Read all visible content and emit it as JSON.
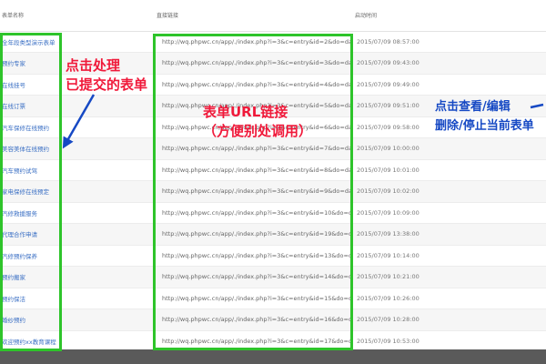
{
  "table": {
    "headers": {
      "name": "表单名称",
      "url": "直接链接",
      "time": "启动时间"
    },
    "rows": [
      {
        "name": "全年段类型演示表单",
        "url": "http://wq.phpwc.cn/app/./index.php?i=3&c=entry&id=2&do=dayu_form",
        "time": "2015/07/09 08:57:00"
      },
      {
        "name": "预约专家",
        "url": "http://wq.phpwc.cn/app/./index.php?i=3&c=entry&id=3&do=dayu_form",
        "time": "2015/07/09 09:43:00"
      },
      {
        "name": "在线挂号",
        "url": "http://wq.phpwc.cn/app/./index.php?i=3&c=entry&id=4&do=dayu_form",
        "time": "2015/07/09 09:49:00"
      },
      {
        "name": "在线订票",
        "url": "http://wq.phpwc.cn/app/./index.php?i=3&c=entry&id=5&do=dayu_form",
        "time": "2015/07/09 09:51:00"
      },
      {
        "name": "汽车保修在线预约",
        "url": "http://wq.phpwc.cn/app/./index.php?i=3&c=entry&id=6&do=dayu_form",
        "time": "2015/07/09 09:58:00"
      },
      {
        "name": "美容美体在线预约",
        "url": "http://wq.phpwc.cn/app/./index.php?i=3&c=entry&id=7&do=dayu_form",
        "time": "2015/07/09 10:00:00"
      },
      {
        "name": "汽车预约试驾",
        "url": "http://wq.phpwc.cn/app/./index.php?i=3&c=entry&id=8&do=dayu_form",
        "time": "2015/07/09 10:01:00"
      },
      {
        "name": "家电保修在线预定",
        "url": "http://wq.phpwc.cn/app/./index.php?i=3&c=entry&id=9&do=dayu_form",
        "time": "2015/07/09 10:02:00"
      },
      {
        "name": "汽修救援服务",
        "url": "http://wq.phpwc.cn/app/./index.php?i=3&c=entry&id=10&do=dayu_form",
        "time": "2015/07/09 10:09:00"
      },
      {
        "name": "代理合作申请",
        "url": "http://wq.phpwc.cn/app/./index.php?i=3&c=entry&id=19&do=dayu_form",
        "time": "2015/07/09 13:38:00"
      },
      {
        "name": "汽修预约保养",
        "url": "http://wq.phpwc.cn/app/./index.php?i=3&c=entry&id=13&do=dayu_form",
        "time": "2015/07/09 10:14:00"
      },
      {
        "name": "预约搬家",
        "url": "http://wq.phpwc.cn/app/./index.php?i=3&c=entry&id=14&do=dayu_form",
        "time": "2015/07/09 10:21:00"
      },
      {
        "name": "预约保洁",
        "url": "http://wq.phpwc.cn/app/./index.php?i=3&c=entry&id=15&do=dayu_form",
        "time": "2015/07/09 10:26:00"
      },
      {
        "name": "婚纱预约",
        "url": "http://wq.phpwc.cn/app/./index.php?i=3&c=entry&id=16&do=dayu_form",
        "time": "2015/07/09 10:28:00"
      },
      {
        "name": "欢迎预约xx教育课程",
        "url": "http://wq.phpwc.cn/app/./index.php?i=3&c=entry&id=17&do=dayu_form",
        "time": "2015/07/09 10:53:00"
      }
    ]
  },
  "annotations": {
    "left": [
      "点击处理",
      "已提交的表单"
    ],
    "middle": [
      "表单URL链接",
      "（方便别处调用）"
    ],
    "right": [
      "点击查看/编辑",
      "删除/停止当前表单"
    ]
  },
  "colors": {
    "highlight_box": "#2ec42a",
    "annotation_red": "#f0193a",
    "annotation_blue": "#1649c4",
    "link": "#3a6fc4"
  }
}
